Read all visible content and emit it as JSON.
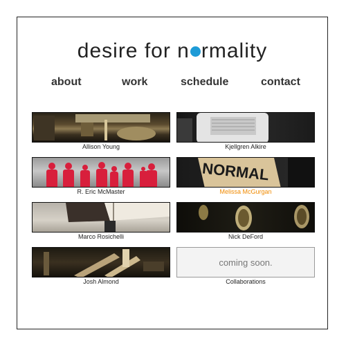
{
  "site": {
    "title_start": "desire for n",
    "title_end": "rmality"
  },
  "nav": {
    "items": [
      {
        "label": "about"
      },
      {
        "label": "work"
      },
      {
        "label": "schedule"
      },
      {
        "label": "contact"
      }
    ]
  },
  "gallery": {
    "tiles": [
      {
        "caption": "Allison Young"
      },
      {
        "caption": "Kjellgren Alkire"
      },
      {
        "caption": "R. Eric McMaster"
      },
      {
        "caption": "Melissa McGurgan",
        "thumb_text": "NORMAL"
      },
      {
        "caption": "Marco Rosichelli"
      },
      {
        "caption": "Nick DeFord"
      },
      {
        "caption": "Josh Almond"
      },
      {
        "caption": "Collaborations",
        "thumb_text": "coming soon."
      }
    ]
  },
  "colors": {
    "logo_dot": "#1e9bd7",
    "highlight_caption": "#f08a00",
    "text": "#333333"
  }
}
